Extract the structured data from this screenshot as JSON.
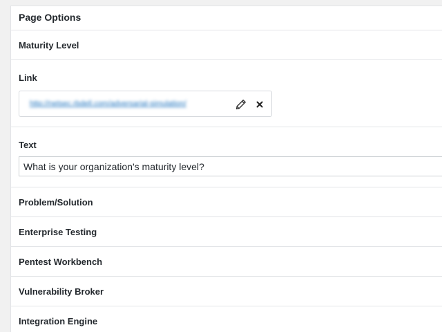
{
  "panel": {
    "title": "Page Options"
  },
  "sections": {
    "maturity_level": "Maturity Level",
    "problem_solution": "Problem/Solution",
    "enterprise_testing": "Enterprise Testing",
    "pentest_workbench": "Pentest Workbench",
    "vulnerability_broker": "Vulnerability Broker",
    "integration_engine": "Integration Engine"
  },
  "link_field": {
    "label": "Link",
    "url": "http://netsec.rbdell.com/adversarial-simulation/",
    "edit_icon": "pencil-icon",
    "remove_icon": "close-icon",
    "link_color": "#1e73be"
  },
  "text_field": {
    "label": "Text",
    "value": "What is your organization's maturity level?"
  }
}
